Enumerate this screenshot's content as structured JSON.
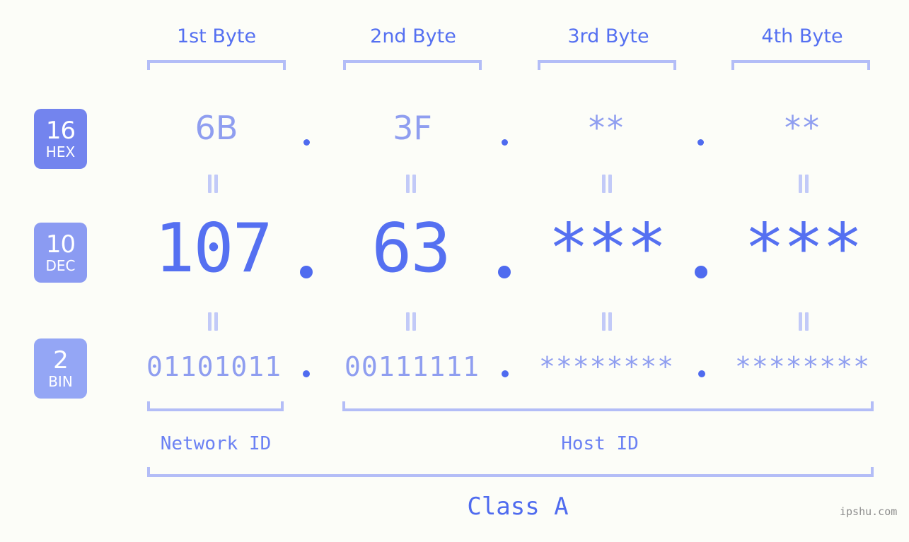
{
  "meta": {
    "background": "#fcfdf8",
    "accent": "#5570f1",
    "accent_light": "#8f9ef0",
    "bracket": "#b3bdf7",
    "watermark": "ipshu.com"
  },
  "byte_headers": [
    {
      "label": "1st Byte"
    },
    {
      "label": "2nd Byte"
    },
    {
      "label": "3rd Byte"
    },
    {
      "label": "4th Byte"
    }
  ],
  "bases": [
    {
      "number": "16",
      "name": "HEX",
      "color": "#7384ee"
    },
    {
      "number": "10",
      "name": "DEC",
      "color": "#8b9bf2"
    },
    {
      "number": "2",
      "name": "BIN",
      "color": "#94a6f5"
    }
  ],
  "rows": {
    "hex": {
      "base_number": "16",
      "base_name": "HEX",
      "values": [
        "6B",
        "3F",
        "**",
        "**"
      ],
      "separator": "."
    },
    "dec": {
      "base_number": "10",
      "base_name": "DEC",
      "values": [
        "107",
        "63",
        "***",
        "***"
      ],
      "separator": "."
    },
    "bin": {
      "base_number": "2",
      "base_name": "BIN",
      "values": [
        "01101011",
        "00111111",
        "********",
        "********"
      ],
      "separator": "."
    }
  },
  "equals_symbol": "=",
  "segments": {
    "network_id": "Network ID",
    "host_id": "Host ID",
    "class": "Class A"
  }
}
